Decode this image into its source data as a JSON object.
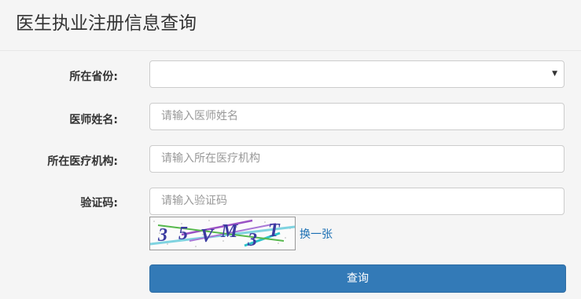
{
  "page": {
    "title": "医生执业注册信息查询"
  },
  "form": {
    "province": {
      "label": "所在省份:",
      "value": ""
    },
    "doctor_name": {
      "label": "医师姓名:",
      "placeholder": "请输入医师姓名"
    },
    "institution": {
      "label": "所在医疗机构:",
      "placeholder": "请输入所在医疗机构"
    },
    "captcha": {
      "label": "验证码:",
      "placeholder": "请输入验证码",
      "image_text": "35VM3T",
      "refresh_label": "换一张"
    },
    "submit_label": "查询"
  },
  "colors": {
    "primary": "#337ab7",
    "link": "#1a6fb3",
    "background": "#f5f5f5"
  },
  "icons": {
    "select_caret": "caret-down-icon"
  }
}
